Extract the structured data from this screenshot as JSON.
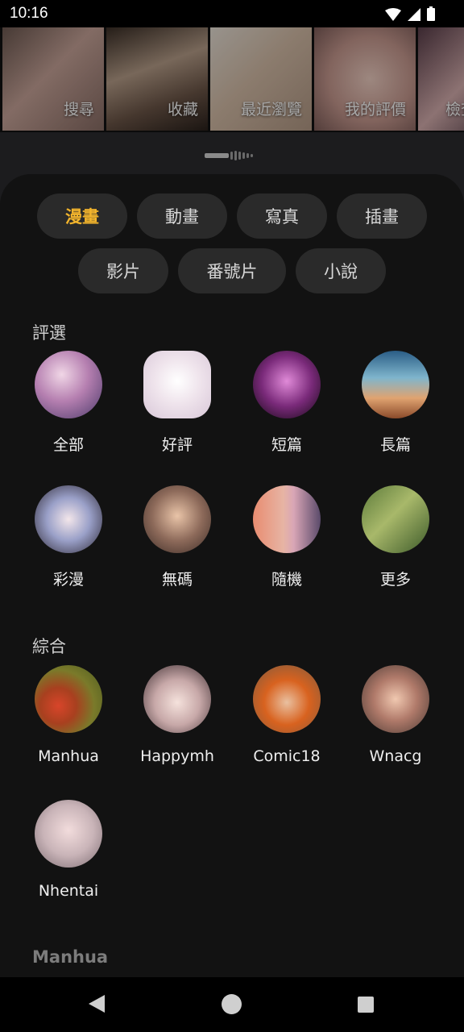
{
  "status_bar": {
    "time": "10:16"
  },
  "banner": {
    "tiles": [
      {
        "label": "搜尋",
        "icon": "search-tile-image"
      },
      {
        "label": "收藏",
        "icon": "favorites-tile-image"
      },
      {
        "label": "最近瀏覽",
        "icon": "history-tile-image"
      },
      {
        "label": "我的評價",
        "icon": "ratings-tile-image"
      },
      {
        "label": "檢查",
        "icon": "partial-tile-image"
      }
    ]
  },
  "categories": {
    "row1": [
      "漫畫",
      "動畫",
      "寫真",
      "插畫"
    ],
    "row2": [
      "影片",
      "番號片",
      "小說"
    ],
    "active": "漫畫",
    "accent_color": "#f2b42c"
  },
  "sections": {
    "selection": {
      "title": "評選",
      "items": [
        "全部",
        "好評",
        "短篇",
        "長篇",
        "彩漫",
        "無碼",
        "隨機",
        "更多"
      ]
    },
    "general": {
      "title": "綜合",
      "items": [
        "Manhua",
        "Happymh",
        "Comic18",
        "Wnacg",
        "Nhentai"
      ]
    },
    "next": {
      "title": "Manhua"
    }
  }
}
